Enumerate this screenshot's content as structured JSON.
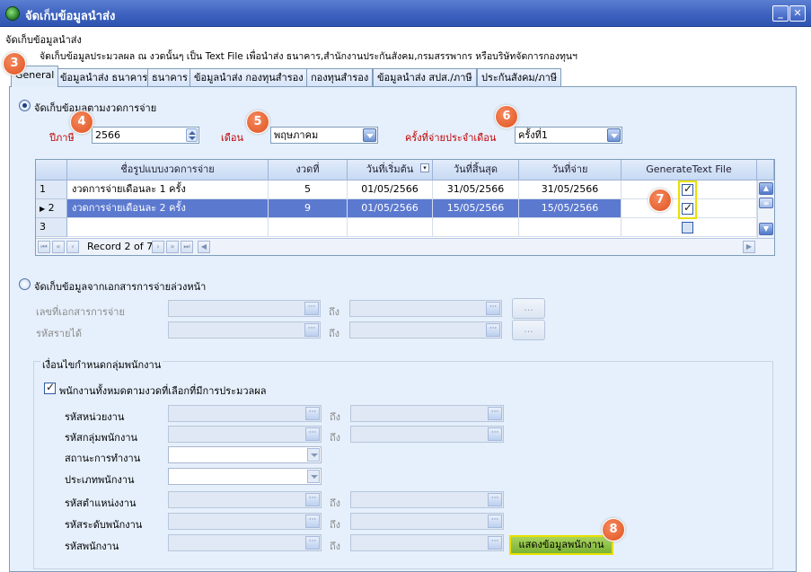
{
  "window": {
    "title": "จัดเก็บข้อมูลนำส่ง",
    "minimize": "_",
    "close": "✕"
  },
  "header": {
    "heading": "จัดเก็บข้อมูลนำส่ง",
    "description": "จัดเก็บข้อมูลประมวลผล ณ งวดนั้นๆ เป็น Text File เพื่อนำส่ง ธนาคาร,สำนักงานประกันสังคม,กรมสรรพากร หรือบริษัทจัดการกองทุนฯ"
  },
  "tabs": [
    {
      "label": "General",
      "active": true
    },
    {
      "label": "ข้อมูลนำส่ง ธนาคาร"
    },
    {
      "label": "ธนาคาร"
    },
    {
      "label": "ข้อมูลนำส่ง กองทุนสำรอง"
    },
    {
      "label": "กองทุนสำรอง"
    },
    {
      "label": "ข้อมูลนำส่ง สปส./ภาษี"
    },
    {
      "label": "ประกันสังคม/ภาษี"
    }
  ],
  "period_section": {
    "radio_label": "จัดเก็บข้อมูลตามงวดการจ่าย",
    "year_label": "ปีภาษี",
    "year_value": "2566",
    "month_label": "เดือน",
    "month_value": "พฤษภาคม",
    "round_label": "ครั้งที่จ่ายประจำเดือน",
    "round_value": "ครั้งที่1"
  },
  "grid": {
    "columns": [
      "",
      "ชื่อรูปแบบงวดการจ่าย",
      "งวดที่",
      "วันที่เริ่มต้น",
      "วันที่สิ้นสุด",
      "วันที่จ่าย",
      "GenerateText File"
    ],
    "rows": [
      {
        "index": "1",
        "name": "งวดการจ่ายเดือนละ 1 ครั้ง",
        "period": "5",
        "start": "01/05/2566",
        "end": "31/05/2566",
        "pay": "31/05/2566",
        "generate": true
      },
      {
        "index": "2",
        "name": "งวดการจ่ายเดือนละ 2 ครั้ง",
        "period": "9",
        "start": "01/05/2566",
        "end": "15/05/2566",
        "pay": "15/05/2566",
        "generate": true,
        "selected": true
      },
      {
        "index": "3",
        "name": "",
        "period": "",
        "start": "",
        "end": "",
        "pay": "",
        "generate": false
      }
    ],
    "record_text": "Record 2 of 7",
    "row_marker": "▶"
  },
  "document_section": {
    "radio_label": "จัดเก็บข้อมูลจากเอกสารการจ่ายล่วงหน้า",
    "doc_label": "เลขที่เอกสารการจ่าย",
    "income_label": "รหัสรายได้",
    "to_label": "ถึง",
    "ellipsis": "..."
  },
  "group": {
    "title": "เงื่อนไขกำหนดกลุ่มพนักงาน",
    "all_employees_label": "พนักงานทั้งหมดตามงวดที่เลือกที่มีการประมวลผล",
    "fields": [
      {
        "label": "รหัสหน่วยงาน"
      },
      {
        "label": "รหัสกลุ่มพนักงาน"
      },
      {
        "label": "สถานะการทำงาน"
      },
      {
        "label": "ประเภทพนักงาน"
      },
      {
        "label": "รหัสตำแหน่งงาน"
      },
      {
        "label": "รหัสระดับพนักงาน"
      },
      {
        "label": "รหัสพนักงาน"
      }
    ],
    "to_label": "ถึง",
    "show_button": "แสดงข้อมูลพนักงาน"
  },
  "badges": [
    "3",
    "4",
    "5",
    "6",
    "7",
    "8"
  ],
  "colors": {
    "title_bar": "#3d62bf",
    "selected_row": "#5b79cf",
    "highlight": "#e8e000",
    "badge": "#e0521f",
    "show_button": "#7ab238"
  }
}
